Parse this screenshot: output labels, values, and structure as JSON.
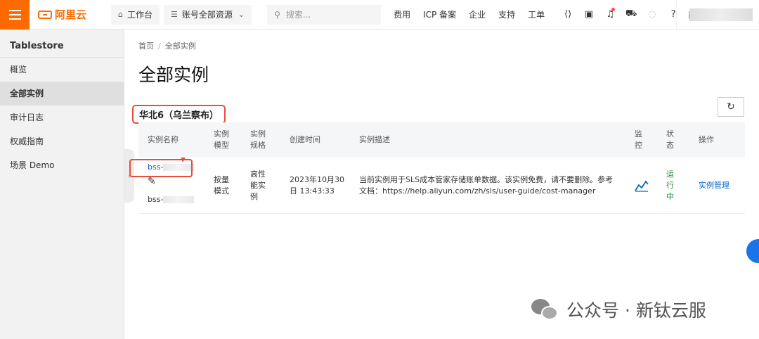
{
  "topbar": {
    "logo_text": "阿里云",
    "workbench": "工作台",
    "resources": "账号全部资源",
    "search_placeholder": "搜索...",
    "links": [
      "费用",
      "ICP 备案",
      "企业",
      "支持",
      "工单"
    ],
    "lang": "简体"
  },
  "sidebar": {
    "product": "Tablestore",
    "items": [
      "概览",
      "全部实例",
      "审计日志",
      "权威指南",
      "场景 Demo"
    ]
  },
  "main": {
    "breadcrumb": [
      "首页",
      "全部实例"
    ],
    "title": "全部实例",
    "region": "华北6（乌兰察布）",
    "columns": {
      "name": "实例名称",
      "model": "实例模型",
      "spec": "实例规格",
      "created": "创建时间",
      "desc": "实例描述",
      "monitor": "监控",
      "status": "状态",
      "ops": "操作"
    },
    "row": {
      "name_link": "bss-",
      "name_sub": "bss-",
      "model": "按量模式",
      "spec": "高性能实例",
      "created": "2023年10月30日 13:43:33",
      "desc": "当前实例用于SLS成本管家存储账单数据。该实例免费，请不要删除。参考文档：https://help.aliyun.com/zh/sls/user-guide/cost-manager",
      "status": "运行中",
      "ops": "实例管理"
    }
  },
  "watermark": "公众号 · 新钛云服",
  "colors": {
    "accent": "#ff6a00",
    "link": "#0064c8",
    "status": "#1e8e3e",
    "highlight": "#e84c3d"
  }
}
